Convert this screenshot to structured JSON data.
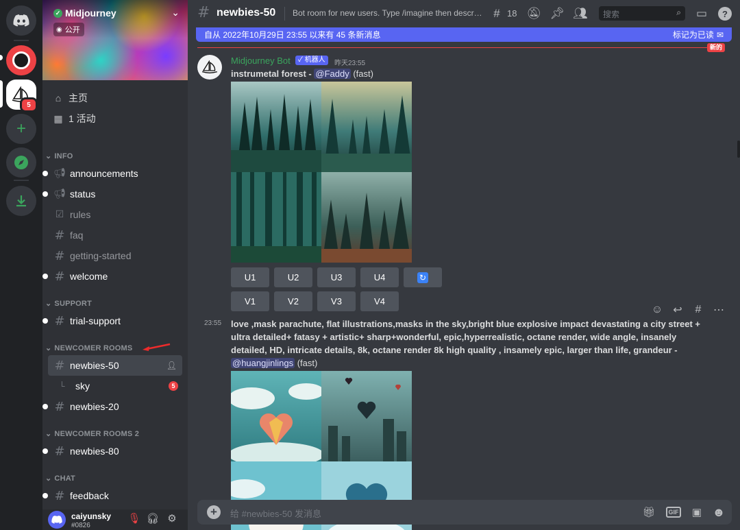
{
  "server": {
    "name": "Midjourney",
    "visibility": "公开"
  },
  "rail": {
    "midjourney_badge": "5"
  },
  "nav": {
    "home": "主页",
    "activity": "1 活动"
  },
  "categories": {
    "info": "INFO",
    "support": "SUPPORT",
    "newcomer": "NEWCOMER ROOMS",
    "newcomer2": "NEWCOMER ROOMS 2",
    "chat": "CHAT"
  },
  "channels": {
    "announcements": "announcements",
    "status": "status",
    "rules": "rules",
    "faq": "faq",
    "getting_started": "getting-started",
    "welcome": "welcome",
    "trial_support": "trial-support",
    "newbies50": "newbies-50",
    "sky": "sky",
    "sky_badge": "5",
    "newbies20": "newbies-20",
    "newbies80": "newbies-80",
    "feedback": "feedback"
  },
  "user": {
    "name": "caiyunsky",
    "tag": "#0826"
  },
  "topbar": {
    "channel": "newbies-50",
    "topic": "Bot room for new users. Type /imagine then describ...",
    "thread_count": "18",
    "search_placeholder": "搜索"
  },
  "new_messages": {
    "text": "自从 2022年10月29日 23:55 以来有 45 条新消息",
    "mark_read": "标记为已读",
    "new_label": "新的"
  },
  "message1": {
    "author": "Midjourney Bot",
    "bot_tag": "✓ 机器人",
    "time": "昨天23:55",
    "prompt": "instrumetal forest",
    "dash": " - ",
    "mention": "@Faddy",
    "speed": "(fast)",
    "buttons_u": [
      "U1",
      "U2",
      "U3",
      "U4"
    ],
    "buttons_v": [
      "V1",
      "V2",
      "V3",
      "V4"
    ]
  },
  "message2": {
    "time": "23:55",
    "line1": "love ,mask parachute, flat illustrations,masks in the sky,bright blue explosive impact devastating a city street +",
    "line2": "ultra detailed+ fatasy + artistic+ sharp+wonderful, epic,hyperrealistic, octane render, wide angle, insanely",
    "line3": "detailed, HD, intricate details, 8k, octane render 8k high quality , insamely epic, larger than life, grandeur -",
    "mention": "@huangjinlings",
    "speed": "(fast)"
  },
  "composer": {
    "placeholder": "给 #newbies-50 发消息"
  },
  "colors": {
    "blurple": "#5865f2",
    "green": "#3ba55d",
    "red": "#ed4245"
  }
}
